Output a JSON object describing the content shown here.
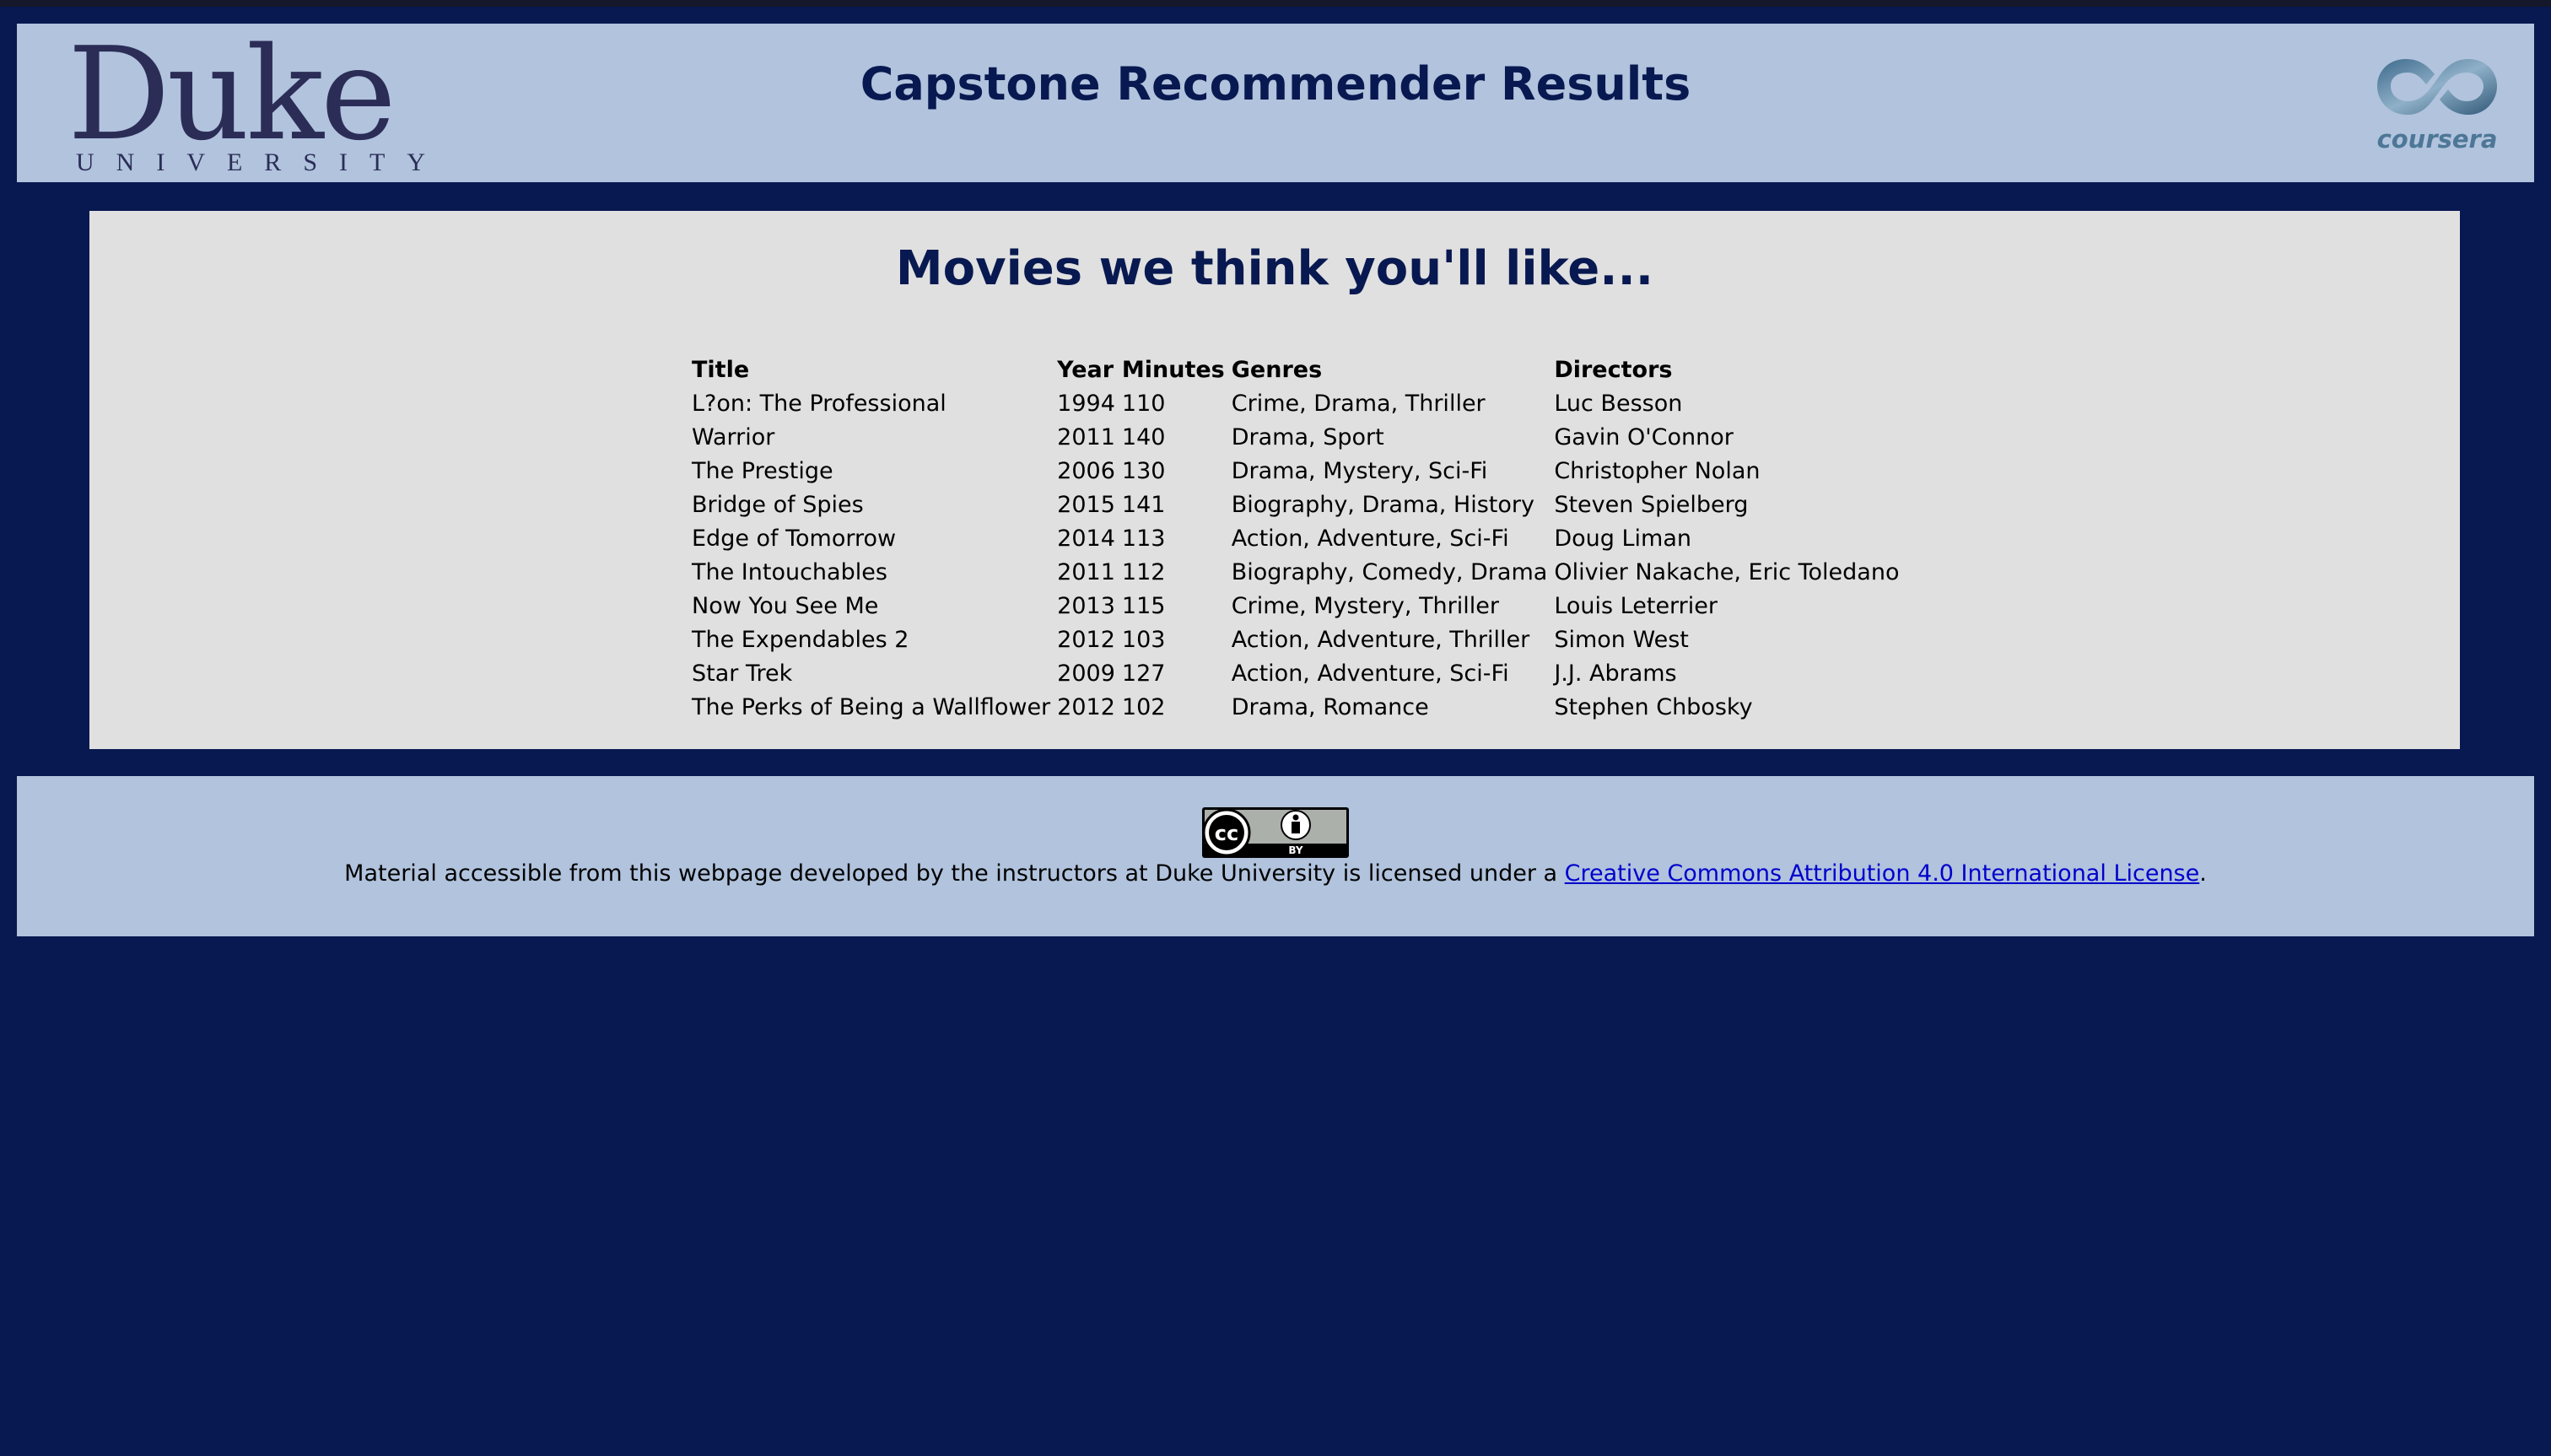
{
  "header": {
    "duke_logo_word": "Duke",
    "duke_logo_subtitle": "UNIVERSITY",
    "site_title": "Capstone Recommender Results",
    "coursera_logo_text": "coursera"
  },
  "main": {
    "heading": "Movies we think you'll like...",
    "columns": [
      "Title",
      "Year",
      "Minutes",
      "Genres",
      "Directors"
    ],
    "rows": [
      {
        "title": "L?on: The Professional",
        "year": "1994",
        "minutes": "110",
        "genres": "Crime, Drama, Thriller",
        "directors": "Luc Besson"
      },
      {
        "title": "Warrior",
        "year": "2011",
        "minutes": "140",
        "genres": "Drama, Sport",
        "directors": "Gavin O'Connor"
      },
      {
        "title": "The Prestige",
        "year": "2006",
        "minutes": "130",
        "genres": "Drama, Mystery, Sci-Fi",
        "directors": "Christopher Nolan"
      },
      {
        "title": "Bridge of Spies",
        "year": "2015",
        "minutes": "141",
        "genres": "Biography, Drama, History",
        "directors": "Steven Spielberg"
      },
      {
        "title": "Edge of Tomorrow",
        "year": "2014",
        "minutes": "113",
        "genres": "Action, Adventure, Sci-Fi",
        "directors": "Doug Liman"
      },
      {
        "title": "The Intouchables",
        "year": "2011",
        "minutes": "112",
        "genres": "Biography, Comedy, Drama",
        "directors": "Olivier Nakache, Eric Toledano"
      },
      {
        "title": "Now You See Me",
        "year": "2013",
        "minutes": "115",
        "genres": "Crime, Mystery, Thriller",
        "directors": "Louis Leterrier"
      },
      {
        "title": "The Expendables 2",
        "year": "2012",
        "minutes": "103",
        "genres": "Action, Adventure, Thriller",
        "directors": "Simon West"
      },
      {
        "title": "Star Trek",
        "year": "2009",
        "minutes": "127",
        "genres": "Action, Adventure, Sci-Fi",
        "directors": "J.J. Abrams"
      },
      {
        "title": "The Perks of Being a Wallflower",
        "year": "2012",
        "minutes": "102",
        "genres": "Drama, Romance",
        "directors": "Stephen Chbosky"
      }
    ]
  },
  "footer": {
    "cc_badge_text": "BY",
    "license_prefix": "Material accessible from this webpage developed by the instructors at Duke University is licensed under a ",
    "license_link": "Creative Commons Attribution 4.0 International License",
    "license_suffix": "."
  },
  "icons": {
    "duke_logo": "duke-logo-icon",
    "coursera_logo": "coursera-logo-icon",
    "cc_badge": "cc-by-license-icon"
  },
  "colors": {
    "page_background": "#081850",
    "banner_background": "#b1c3dd",
    "panel_background": "#e0e0e0",
    "heading_text": "#081850",
    "link": "#0000cc",
    "duke_logo": "#2b2d57",
    "coursera_logo": "#4d7796"
  }
}
